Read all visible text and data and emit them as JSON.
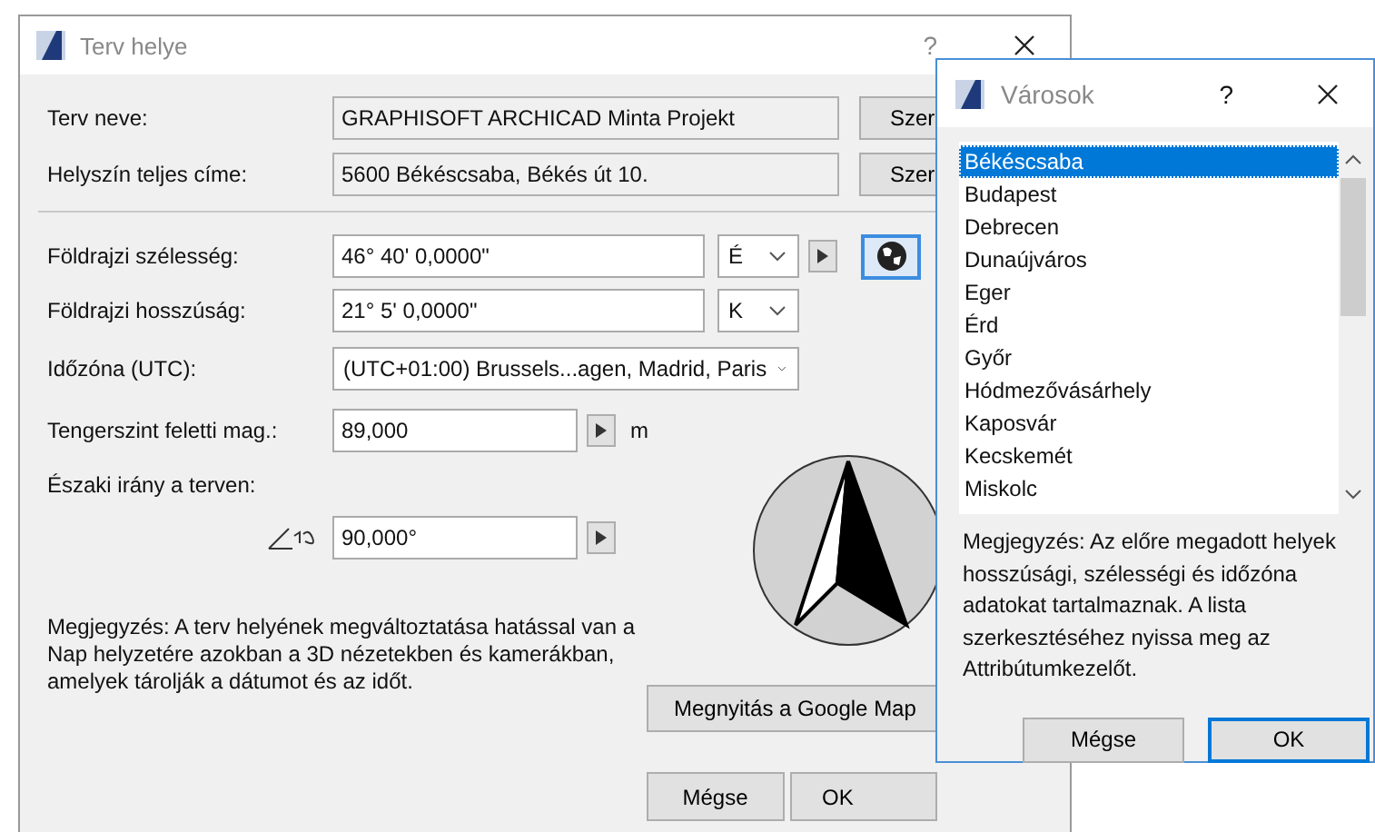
{
  "main_window": {
    "title": "Terv helye",
    "help": "?",
    "project_name": {
      "label": "Terv neve:",
      "value": "GRAPHISOFT ARCHICAD Minta Projekt",
      "button": "Szer"
    },
    "address": {
      "label": "Helyszín teljes címe:",
      "value": "5600 Békéscsaba, Békés út 10.",
      "button": "Szer"
    },
    "latitude": {
      "label": "Földrajzi szélesség:",
      "value": "46° 40' 0,0000\"",
      "hemisphere": "É"
    },
    "longitude": {
      "label": "Földrajzi hosszúság:",
      "value": "21° 5' 0,0000\"",
      "hemisphere": "K"
    },
    "timezone": {
      "label": "Időzóna (UTC):",
      "value": "(UTC+01:00) Brussels...agen, Madrid, Paris"
    },
    "elevation": {
      "label": "Tengerszint feletti mag.:",
      "value": "89,000",
      "unit": "m"
    },
    "north": {
      "label": "Északi irány a terven:",
      "value": "90,000°"
    },
    "note": "Megjegyzés: A terv helyének megváltoztatása hatással van a Nap helyzetére azokban a 3D nézetekben és kamerákban, amelyek tárolják a dátumot és az időt.",
    "maps_button": "Megnyitás a Google Map",
    "cancel": "Mégse",
    "ok": "OK"
  },
  "cities_window": {
    "title": "Városok",
    "help": "?",
    "cities": [
      {
        "name": "Békéscsaba",
        "selected": true
      },
      {
        "name": "Budapest",
        "selected": false
      },
      {
        "name": "Debrecen",
        "selected": false
      },
      {
        "name": "Dunaújváros",
        "selected": false
      },
      {
        "name": "Eger",
        "selected": false
      },
      {
        "name": "Érd",
        "selected": false
      },
      {
        "name": "Győr",
        "selected": false
      },
      {
        "name": "Hódmezővásárhely",
        "selected": false
      },
      {
        "name": "Kaposvár",
        "selected": false
      },
      {
        "name": "Kecskemét",
        "selected": false
      },
      {
        "name": "Miskolc",
        "selected": false
      }
    ],
    "note": "Megjegyzés: Az előre megadott helyek hosszúsági, szélességi és időzóna adatokat tartalmaznak. A lista szerkesztéséhez nyissa meg az Attribútumkezelőt.",
    "cancel": "Mégse",
    "ok": "OK"
  }
}
